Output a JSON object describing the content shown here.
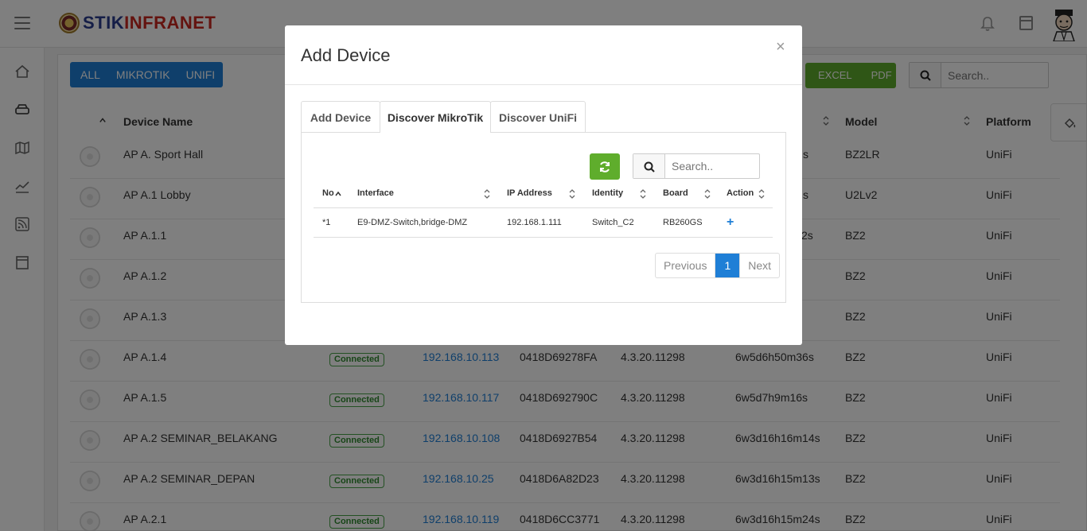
{
  "brand": {
    "part1": "STIK",
    "part2": "INFRANET"
  },
  "filters": [
    "ALL",
    "MIKROTIK",
    "UNIFI"
  ],
  "export": {
    "excel": "EXCEL",
    "pdf": "PDF"
  },
  "search": {
    "placeholder": "Search.."
  },
  "table": {
    "headers": {
      "device_name": "Device Name",
      "model": "Model",
      "platform": "Platform"
    },
    "rows": [
      {
        "name": "AP A. Sport Hall",
        "status": "",
        "ip": "",
        "mac": "",
        "version": "",
        "uptime": "s",
        "model": "BZ2LR",
        "platform": "UniFi"
      },
      {
        "name": "AP A.1 Lobby",
        "status": "",
        "ip": "",
        "mac": "",
        "version": "",
        "uptime": "s",
        "model": "U2Lv2",
        "platform": "UniFi"
      },
      {
        "name": "AP A.1.1",
        "status": "",
        "ip": "",
        "mac": "",
        "version": "",
        "uptime": "2s",
        "model": "BZ2",
        "platform": "UniFi"
      },
      {
        "name": "AP A.1.2",
        "status": "",
        "ip": "",
        "mac": "",
        "version": "",
        "uptime": "",
        "model": "BZ2",
        "platform": "UniFi"
      },
      {
        "name": "AP A.1.3",
        "status": "",
        "ip": "",
        "mac": "",
        "version": "",
        "uptime": "",
        "model": "BZ2",
        "platform": "UniFi"
      },
      {
        "name": "AP A.1.4",
        "status": "Connected",
        "ip": "192.168.10.113",
        "mac": "0418D69278FA",
        "version": "4.3.20.11298",
        "uptime": "6w5d6h50m36s",
        "model": "BZ2",
        "platform": "UniFi"
      },
      {
        "name": "AP A.1.5",
        "status": "Connected",
        "ip": "192.168.10.117",
        "mac": "0418D692790C",
        "version": "4.3.20.11298",
        "uptime": "6w5d7h9m16s",
        "model": "BZ2",
        "platform": "UniFi"
      },
      {
        "name": "AP A.2 SEMINAR_BELAKANG",
        "status": "Connected",
        "ip": "192.168.10.108",
        "mac": "0418D6927B54",
        "version": "4.3.20.11298",
        "uptime": "6w3d16h16m14s",
        "model": "BZ2",
        "platform": "UniFi"
      },
      {
        "name": "AP A.2 SEMINAR_DEPAN",
        "status": "Connected",
        "ip": "192.168.10.25",
        "mac": "0418D6A82D23",
        "version": "4.3.20.11298",
        "uptime": "6w3d16h15m13s",
        "model": "BZ2",
        "platform": "UniFi"
      },
      {
        "name": "AP A.2.1",
        "status": "Connected",
        "ip": "192.168.10.119",
        "mac": "0418D6CC3771",
        "version": "4.3.20.11298",
        "uptime": "6w3d16h15m24s",
        "model": "BZ2",
        "platform": "UniFi"
      }
    ]
  },
  "modal": {
    "title": "Add Device",
    "close": "×",
    "tabs": [
      "Add Device",
      "Discover MikroTik",
      "Discover UniFi"
    ],
    "active_tab": 1,
    "search_placeholder": "Search..",
    "columns": [
      "No",
      "Interface",
      "IP Address",
      "Identity",
      "Board",
      "Action"
    ],
    "rows": [
      {
        "no": "*1",
        "interface": "E9-DMZ-Switch,bridge-DMZ",
        "ip": "192.168.1.111",
        "identity": "Switch_C2",
        "board": "RB260GS",
        "action": "+"
      }
    ],
    "pager": {
      "prev": "Previous",
      "current": "1",
      "next": "Next"
    }
  },
  "colors": {
    "primary": "#1f7fd6",
    "success": "#5fad2c",
    "brand_blue": "#2b3c8f",
    "brand_red": "#c8261f"
  }
}
